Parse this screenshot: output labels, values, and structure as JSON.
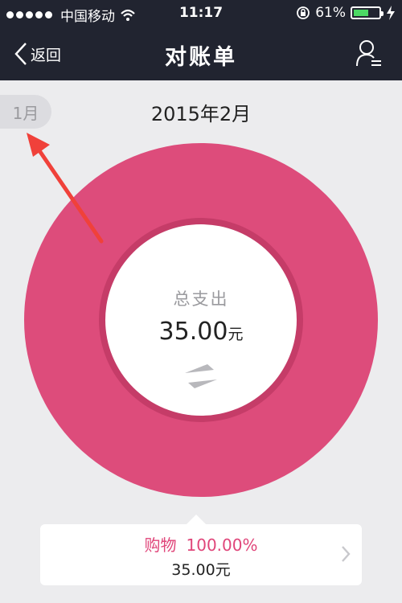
{
  "status": {
    "carrier": "中国移动",
    "time": "11:17",
    "battery": "61%",
    "battery_level": 0.61
  },
  "nav": {
    "back_label": "返回",
    "title": "对账单"
  },
  "month_tab": "1月",
  "current_month": "2015年2月",
  "summary": {
    "label": "总支出",
    "amount": "35.00",
    "unit": "元"
  },
  "category": {
    "name": "购物",
    "percent": "100.00%",
    "amount": "35.00元"
  },
  "colors": {
    "nav_bg": "#212430",
    "donut": "#dd4c7b",
    "donut_inner_ring": "#c53c68",
    "accent_text": "#e0467a",
    "annotation_arrow": "#f0413a"
  }
}
